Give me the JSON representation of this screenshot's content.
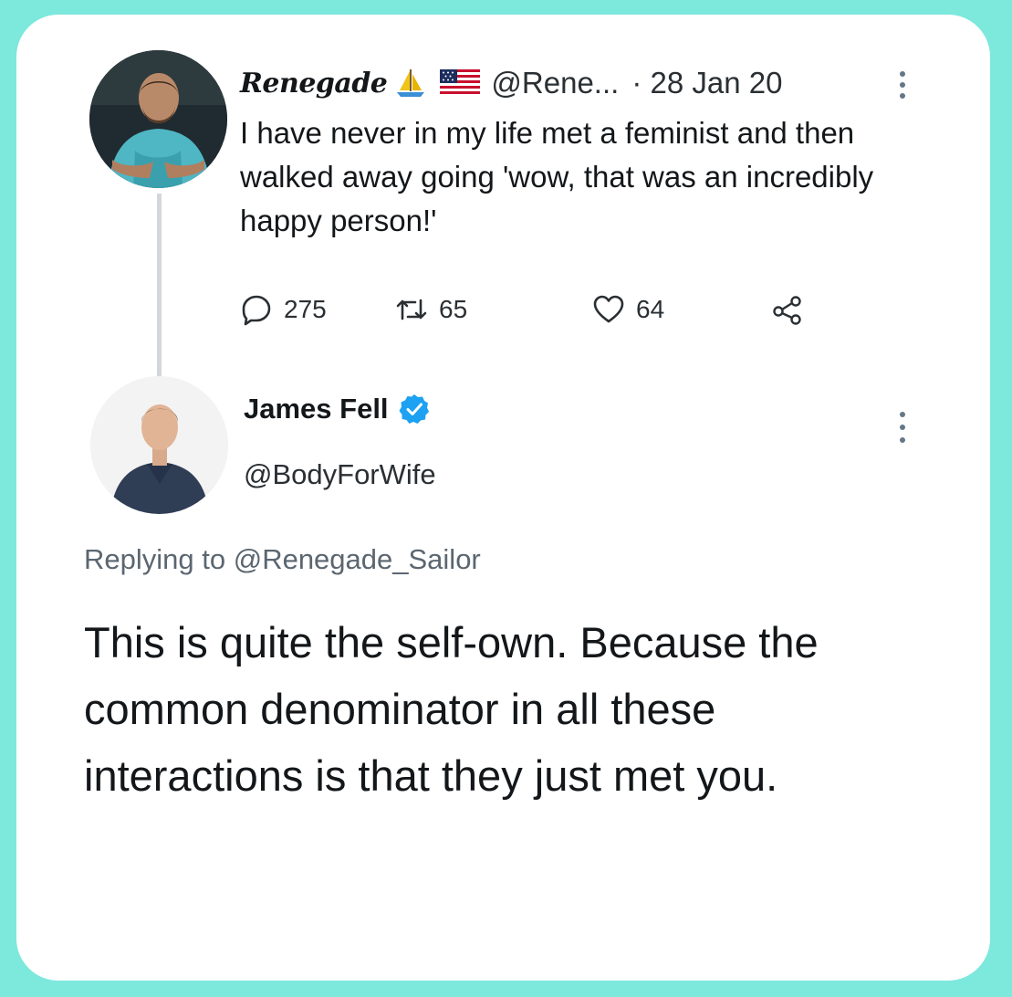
{
  "original_tweet": {
    "display_name": "Renegade",
    "handle": "@Rene...",
    "date": "· 28 Jan 20",
    "text": "I have never in my life met a feminist and then walked away going 'wow, that was an incredibly happy person!'",
    "reply_count": "275",
    "retweet_count": "65",
    "like_count": "64",
    "icons": [
      "sailboat-icon",
      "us-flag-icon",
      "more-options-icon",
      "reply-icon",
      "retweet-icon",
      "like-icon",
      "share-icon"
    ]
  },
  "reply_tweet": {
    "display_name": "James Fell",
    "handle": "@BodyForWife",
    "replying_to_prefix": "Replying to",
    "replying_to_handle": "@Renegade_Sailor",
    "text": "This is quite the self-own. Because the common denominator in all these interactions is that they just met you.",
    "icons": [
      "verified-badge-icon",
      "more-options-icon"
    ]
  },
  "colors": {
    "background": "#7de8dc",
    "card": "#ffffff",
    "verified": "#1da1f2",
    "secondary_text": "#5b6670"
  }
}
